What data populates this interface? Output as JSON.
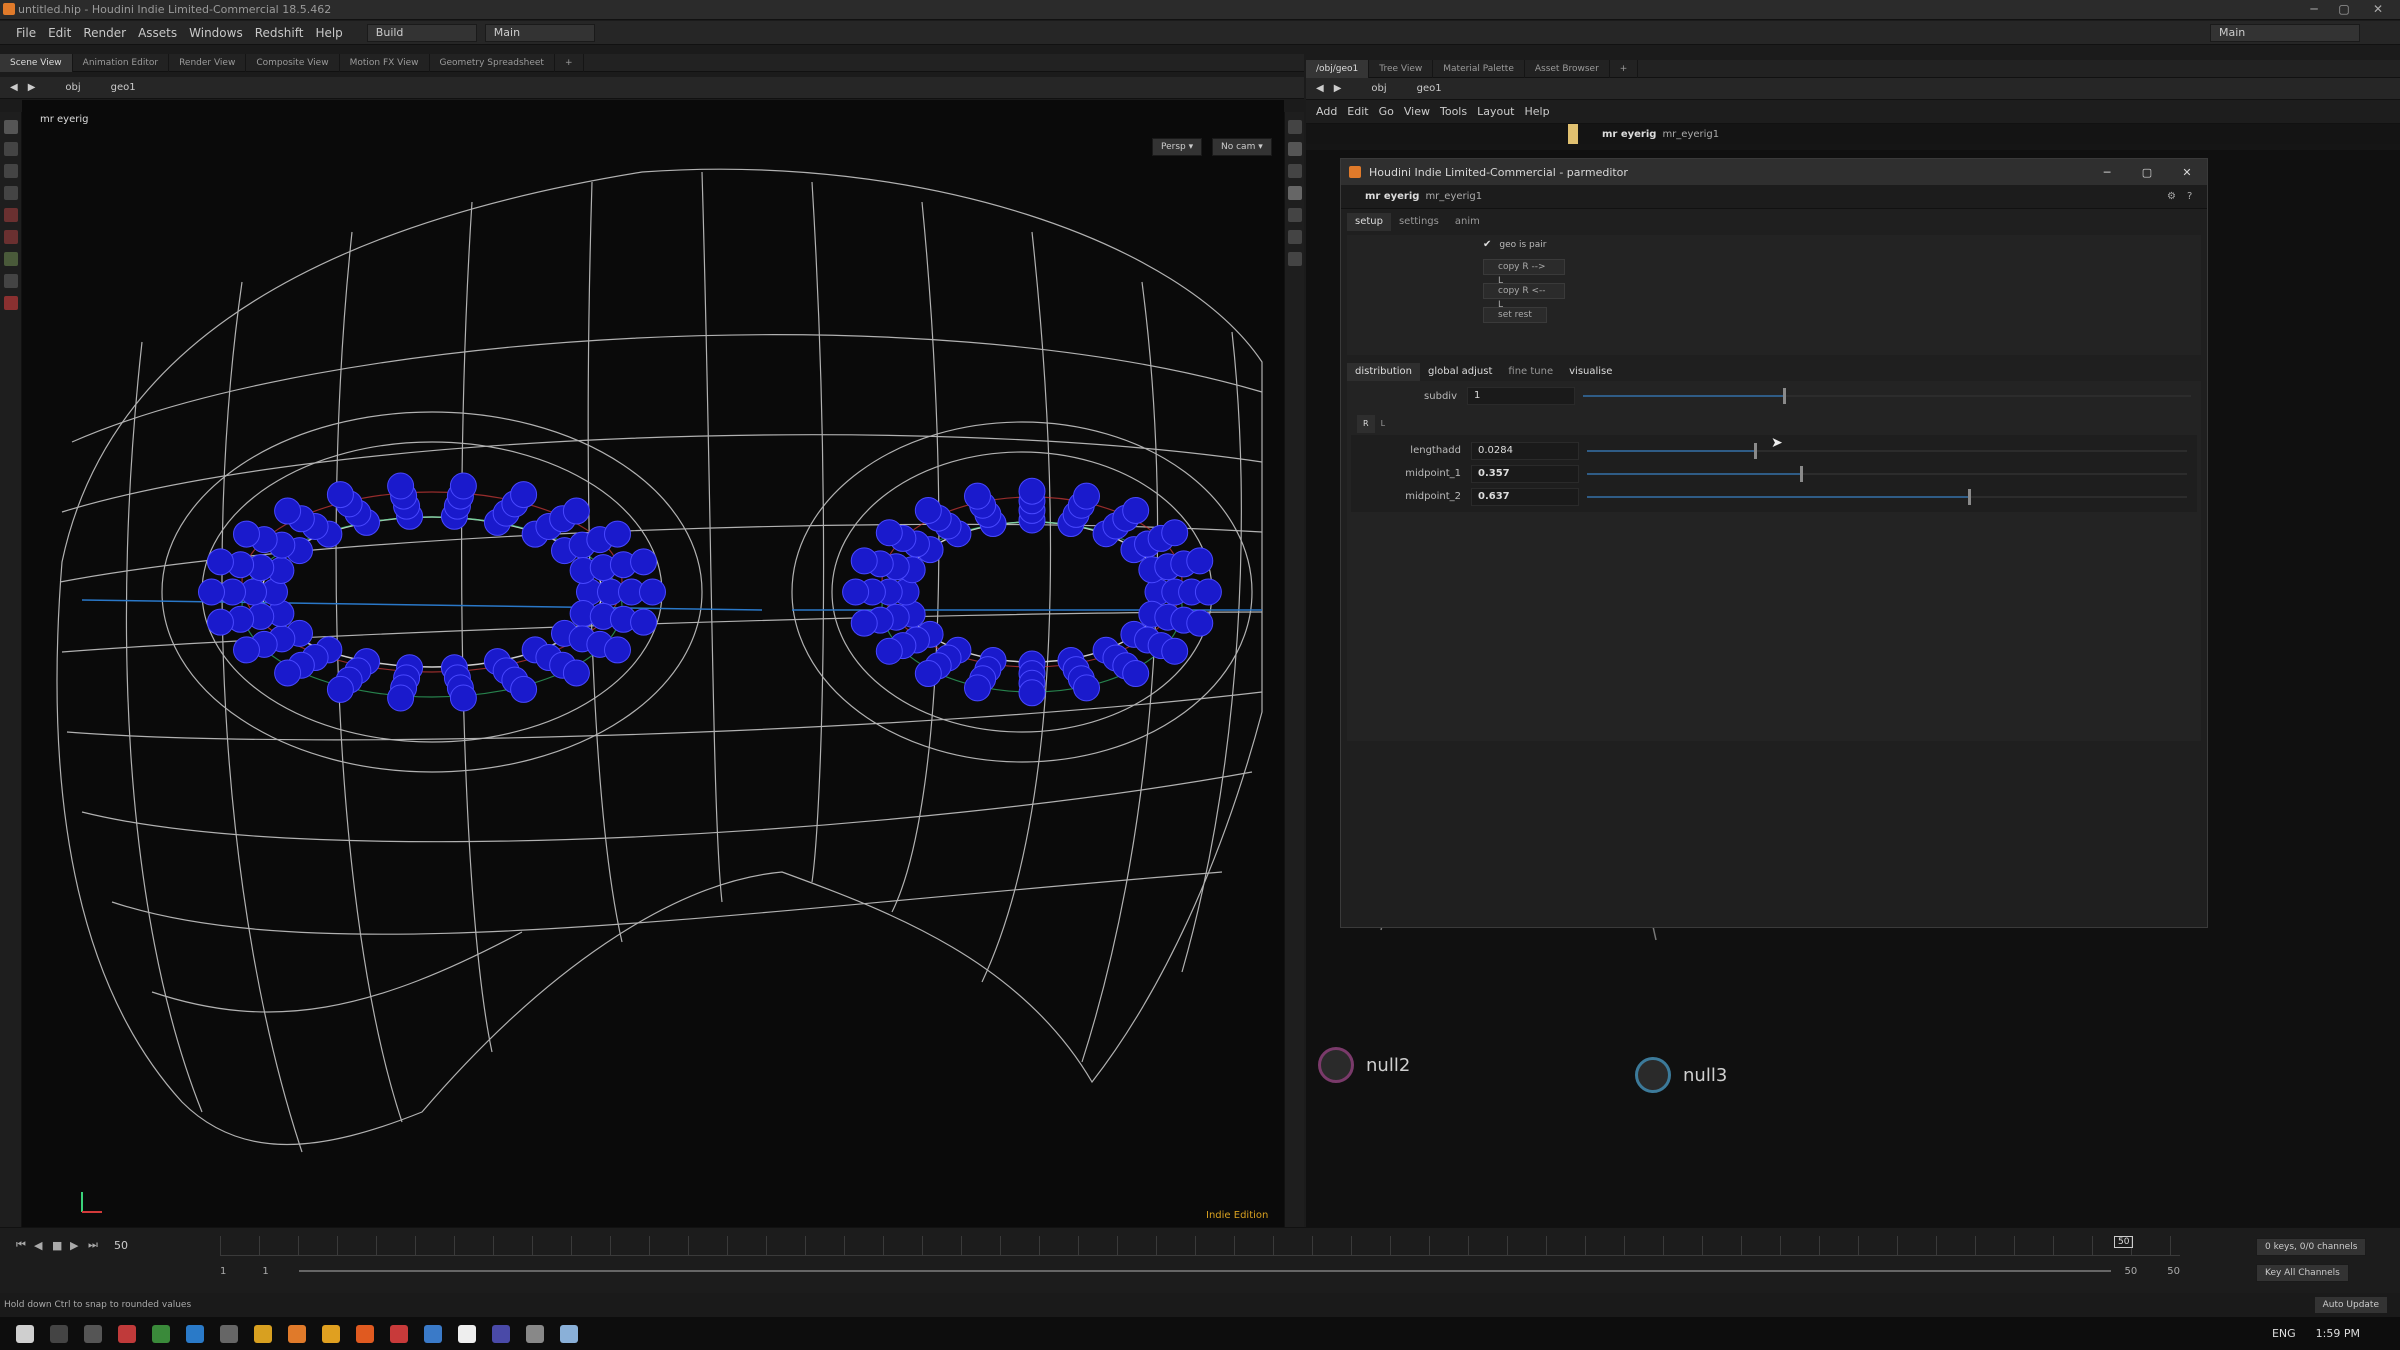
{
  "window": {
    "title": "untitled.hip - Houdini Indie Limited-Commercial 18.5.462"
  },
  "menu": {
    "items": [
      "File",
      "Edit",
      "Render",
      "Assets",
      "Windows",
      "Redshift",
      "Help"
    ],
    "desktop": "Build",
    "desktop2": "Main",
    "right_desktop": "Main"
  },
  "left_tabs": [
    "Scene View",
    "Animation Editor",
    "Render View",
    "Composite View",
    "Motion FX View",
    "Geometry Spreadsheet"
  ],
  "left_path": {
    "root": "obj",
    "node": "geo1"
  },
  "viewport": {
    "label": "mr eyerig",
    "persp": "Persp",
    "cam": "No cam",
    "edition": "Indie Edition"
  },
  "right_tabs": [
    "/obj/geo1",
    "Tree View",
    "Material Palette",
    "Asset Browser"
  ],
  "right_path": {
    "root": "obj",
    "node": "geo1"
  },
  "network_menu": [
    "Add",
    "Edit",
    "Go",
    "View",
    "Tools",
    "Layout",
    "Help"
  ],
  "network_header": {
    "type": "mr eyerig",
    "name": "mr_eyerig1"
  },
  "parmeditor": {
    "title": "Houdini Indie Limited-Commercial - parmeditor",
    "type": "mr eyerig",
    "name": "mr_eyerig1",
    "tabs": [
      "setup",
      "settings",
      "anim"
    ],
    "geo_is_pair": "geo is pair",
    "buttons": [
      "copy R --> L",
      "copy R <-- L",
      "set rest"
    ],
    "subtabs": [
      "distribution",
      "global adjust",
      "fine tune",
      "visualise"
    ],
    "subdiv": {
      "label": "subdiv",
      "value": "1",
      "fraction": 0.33
    },
    "mini_tabs": [
      "R",
      "L"
    ],
    "params": [
      {
        "label": "lengthadd",
        "value": "0.0284",
        "fraction": 0.28
      },
      {
        "label": "midpoint_1",
        "value": "0.357",
        "fraction": 0.357
      },
      {
        "label": "midpoint_2",
        "value": "0.637",
        "fraction": 0.637
      }
    ]
  },
  "nodes": [
    {
      "name": "null2"
    },
    {
      "name": "null3"
    }
  ],
  "timeline": {
    "frame": "50",
    "start": "1",
    "start2": "1",
    "end": "50",
    "end2": "50",
    "marker": "50",
    "keys": "0 keys, 0/0 channels",
    "key_all": "Key All Channels",
    "auto_update": "Auto Update"
  },
  "status": {
    "hint": "Hold down Ctrl to snap to rounded values"
  },
  "taskbar": {
    "lang": "ENG",
    "time": "1:59 PM"
  },
  "colors": {
    "accent": "#e07a2a",
    "wire": "#d9d9d9",
    "spheres": "#1a1acc",
    "guide_red": "#d23a3a",
    "guide_green": "#3ad27a",
    "axis_blue": "#2a78c8"
  }
}
